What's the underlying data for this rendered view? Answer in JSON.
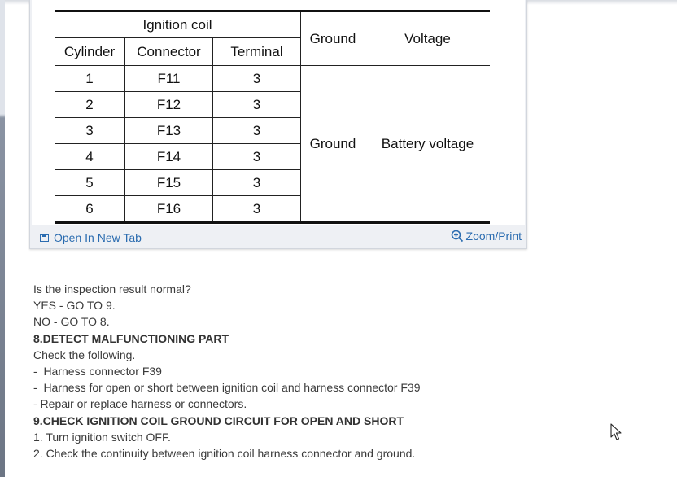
{
  "table": {
    "header_group": "Ignition coil",
    "headers": {
      "cylinder": "Cylinder",
      "connector": "Connector",
      "terminal": "Terminal",
      "ground": "Ground",
      "voltage": "Voltage"
    },
    "rows": [
      {
        "cylinder": "1",
        "connector": "F11",
        "terminal": "3"
      },
      {
        "cylinder": "2",
        "connector": "F12",
        "terminal": "3"
      },
      {
        "cylinder": "3",
        "connector": "F13",
        "terminal": "3"
      },
      {
        "cylinder": "4",
        "connector": "F14",
        "terminal": "3"
      },
      {
        "cylinder": "5",
        "connector": "F15",
        "terminal": "3"
      },
      {
        "cylinder": "6",
        "connector": "F16",
        "terminal": "3"
      }
    ],
    "ground_value": "Ground",
    "voltage_value": "Battery voltage"
  },
  "footer": {
    "open_new_tab": "Open In New Tab",
    "zoom_print": "Zoom/Print"
  },
  "content": {
    "lines": [
      "Is the inspection result normal?",
      "YES - GO TO 9.",
      "NO - GO TO 8.",
      "8.DETECT MALFUNCTIONING PART",
      "Check the following.",
      "-  Harness connector F39",
      "-  Harness for open or short between ignition coil and harness connector F39",
      "- Repair or replace harness or connectors.",
      "9.CHECK IGNITION COIL GROUND CIRCUIT FOR OPEN AND SHORT",
      "1. Turn ignition switch OFF.",
      "2. Check the continuity between ignition coil harness connector and ground."
    ]
  },
  "colors": {
    "link": "#2b6cb0",
    "text": "#3a3a3a"
  }
}
